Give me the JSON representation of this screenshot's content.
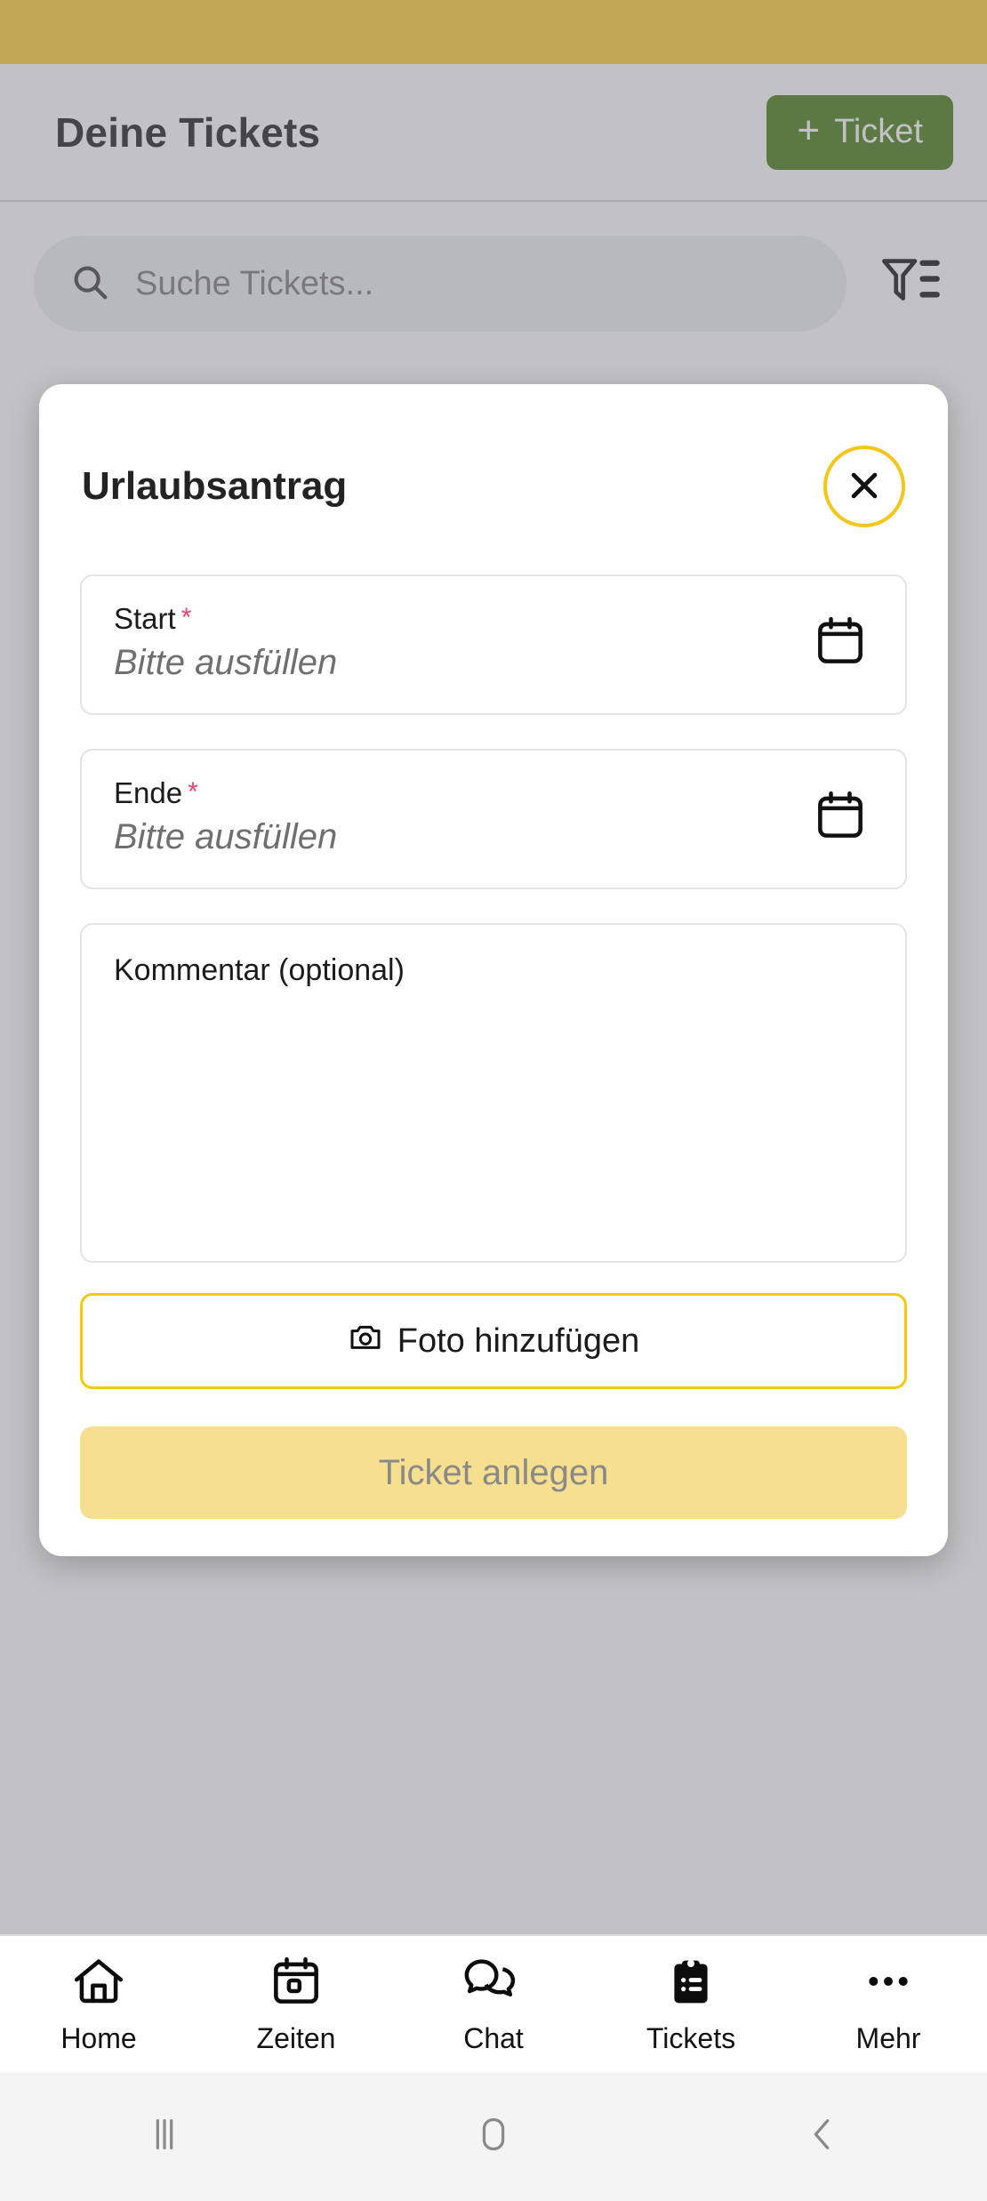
{
  "status_bar": {
    "color": "#FFD034"
  },
  "header": {
    "title": "Deine Tickets",
    "add_button": {
      "plus": "+",
      "label": "Ticket",
      "color": "#467A12"
    }
  },
  "search": {
    "placeholder": "Suche Tickets...",
    "icon": "search-icon",
    "filter_icon": "filter-icon"
  },
  "modal": {
    "title": "Urlaubsantrag",
    "close_icon": "close-icon",
    "accent_color": "#F5C518",
    "fields": [
      {
        "label": "Start",
        "required_marker": "*",
        "value": "Bitte ausfüllen",
        "icon": "calendar-icon"
      },
      {
        "label": "Ende",
        "required_marker": "*",
        "value": "Bitte ausfüllen",
        "icon": "calendar-icon"
      }
    ],
    "comment": {
      "placeholder": "Kommentar (optional)",
      "value": ""
    },
    "photo_button": {
      "label": "Foto hinzufügen",
      "icon": "camera-icon"
    },
    "submit_button": {
      "label": "Ticket anlegen",
      "enabled": false
    }
  },
  "bottom_nav": {
    "items": [
      {
        "label": "Home",
        "icon": "home-icon",
        "active": false
      },
      {
        "label": "Zeiten",
        "icon": "calendar-icon",
        "active": false
      },
      {
        "label": "Chat",
        "icon": "chat-icon",
        "active": false
      },
      {
        "label": "Tickets",
        "icon": "clipboard-icon",
        "active": true
      },
      {
        "label": "Mehr",
        "icon": "more-dots-icon",
        "active": false
      }
    ]
  },
  "system_nav": {
    "recents_icon": "recents-icon",
    "home_icon": "home-square-icon",
    "back_icon": "back-chevron-icon"
  }
}
